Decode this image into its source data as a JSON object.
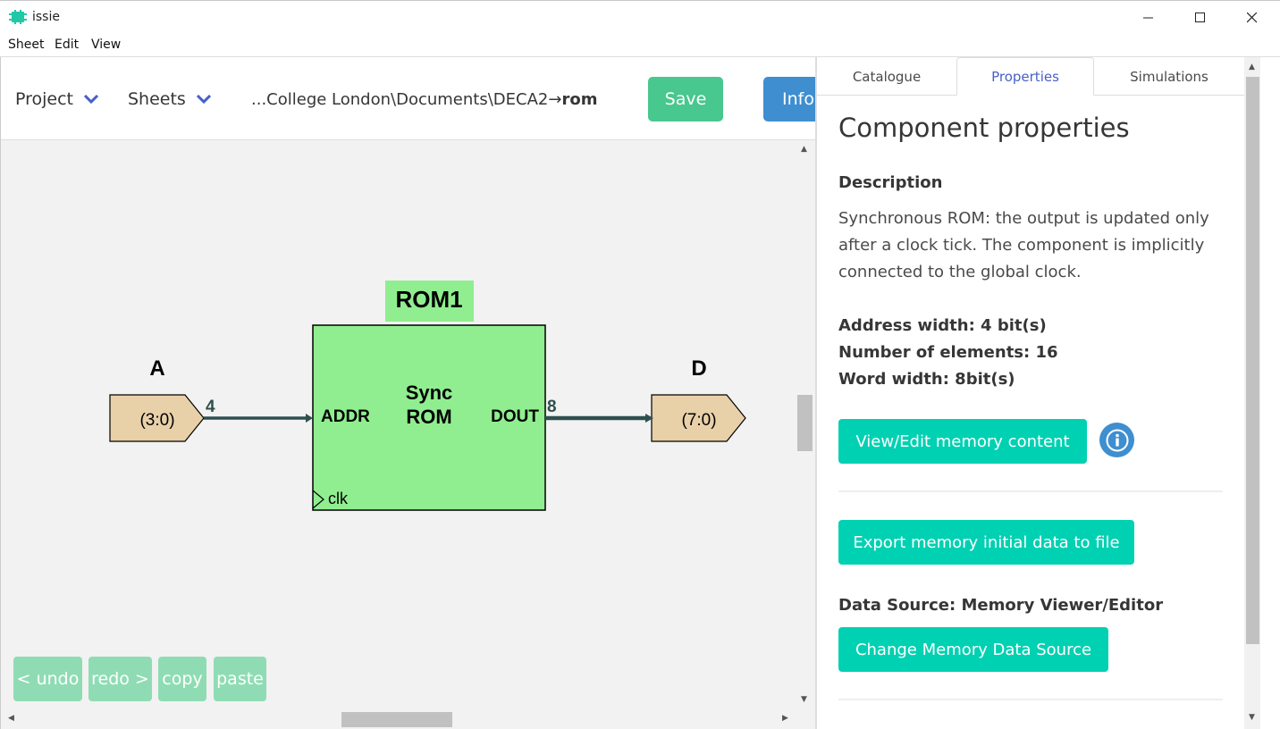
{
  "window": {
    "title": "issie"
  },
  "menu": [
    "Sheet",
    "Edit",
    "View"
  ],
  "toolbar": {
    "project_label": "Project",
    "sheets_label": "Sheets",
    "path_prefix": "...College London\\Documents\\DECA2",
    "path_arrow": "→",
    "path_sheet": "rom",
    "save_label": "Save",
    "info_label": "Info"
  },
  "diagram": {
    "component_label": "ROM1",
    "component_name_line1": "Sync",
    "component_name_line2": "ROM",
    "port_addr": "ADDR",
    "port_dout": "DOUT",
    "port_clk": "clk",
    "input_label": "A",
    "input_range": "(3:0)",
    "input_width": "4",
    "output_label": "D",
    "output_range": "(7:0)",
    "output_width": "8"
  },
  "edit_buttons": {
    "undo": "< undo",
    "redo": "redo >",
    "copy": "copy",
    "paste": "paste"
  },
  "tabs": [
    "Catalogue",
    "Properties",
    "Simulations"
  ],
  "properties": {
    "title": "Component properties",
    "description_heading": "Description",
    "description": "Synchronous ROM: the output is updated only after a clock tick. The component is implicitly connected to the global clock.",
    "address_width": "Address width: 4 bit(s)",
    "num_elements": "Number of elements: 16",
    "word_width": "Word width: 8bit(s)",
    "view_edit_button": "View/Edit memory content",
    "export_button": "Export memory initial data to file",
    "data_source": "Data Source: Memory Viewer/Editor",
    "change_source_button": "Change Memory Data Source"
  },
  "colors": {
    "save": "#48c78e",
    "info": "#3e8ed0",
    "primary": "#00d1b2",
    "component_fill": "#90ee90",
    "port_fill": "#e8d0a9",
    "wire": "#2f4f4f"
  }
}
